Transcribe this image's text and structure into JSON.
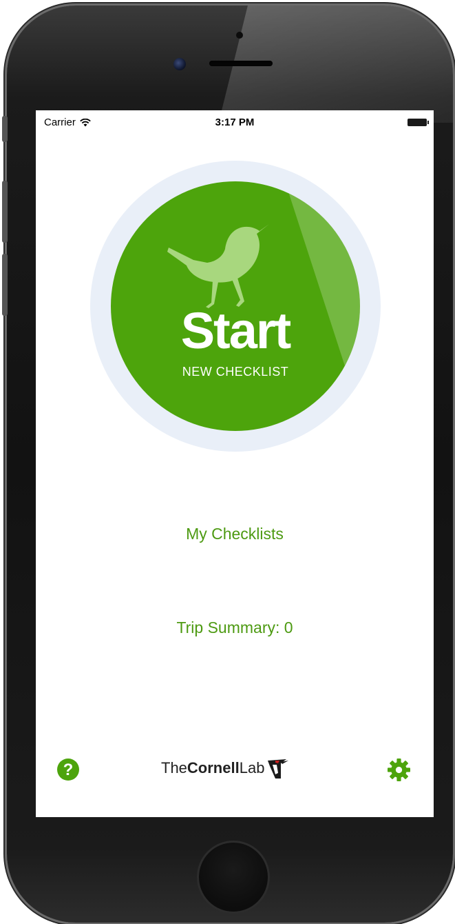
{
  "status_bar": {
    "carrier": "Carrier",
    "time": "3:17 PM"
  },
  "start": {
    "title": "Start",
    "subtitle": "NEW CHECKLIST"
  },
  "menu": {
    "my_checklists": "My Checklists",
    "trip_summary": "Trip Summary: 0"
  },
  "footer": {
    "logo_parts": {
      "the": "The",
      "cornell": "Cornell",
      "lab": "Lab"
    },
    "help_icon": "help-icon",
    "settings_icon": "gear-icon"
  },
  "colors": {
    "accent_green": "#4da40c",
    "link_green": "#4d9a12",
    "ring": "#e9eff8"
  }
}
